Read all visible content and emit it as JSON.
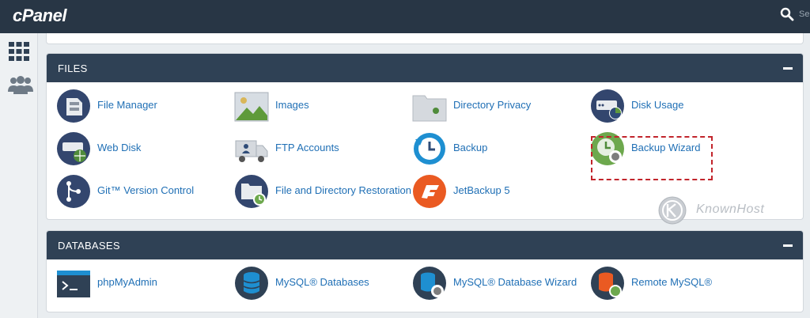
{
  "app": {
    "logo_text": "cPanel"
  },
  "search": {
    "text": "Se"
  },
  "rail": {
    "icons": [
      "grid-icon",
      "users-icon"
    ]
  },
  "sections": {
    "files": {
      "title": "FILES",
      "items": [
        {
          "label": "File Manager",
          "icon": "file-manager-icon"
        },
        {
          "label": "Images",
          "icon": "images-icon"
        },
        {
          "label": "Directory Privacy",
          "icon": "directory-privacy-icon"
        },
        {
          "label": "Disk Usage",
          "icon": "disk-usage-icon"
        },
        {
          "label": "Web Disk",
          "icon": "web-disk-icon"
        },
        {
          "label": "FTP Accounts",
          "icon": "ftp-accounts-icon"
        },
        {
          "label": "Backup",
          "icon": "backup-icon"
        },
        {
          "label": "Backup Wizard",
          "icon": "backup-wizard-icon"
        },
        {
          "label": "Git™ Version Control",
          "icon": "git-icon"
        },
        {
          "label": "File and Directory Restoration",
          "icon": "restoration-icon"
        },
        {
          "label": "JetBackup 5",
          "icon": "jetbackup-icon"
        }
      ]
    },
    "databases": {
      "title": "DATABASES",
      "items": [
        {
          "label": "phpMyAdmin",
          "icon": "phpmyadmin-icon"
        },
        {
          "label": "MySQL® Databases",
          "icon": "mysql-databases-icon"
        },
        {
          "label": "MySQL® Database Wizard",
          "icon": "mysql-wizard-icon"
        },
        {
          "label": "Remote MySQL®",
          "icon": "remote-mysql-icon"
        }
      ]
    }
  },
  "watermark": {
    "text": "KnownHost"
  },
  "colors": {
    "topbar": "#283645",
    "panel_header": "#2f4155",
    "link": "#1f6fb5",
    "highlight": "#c2252c"
  }
}
